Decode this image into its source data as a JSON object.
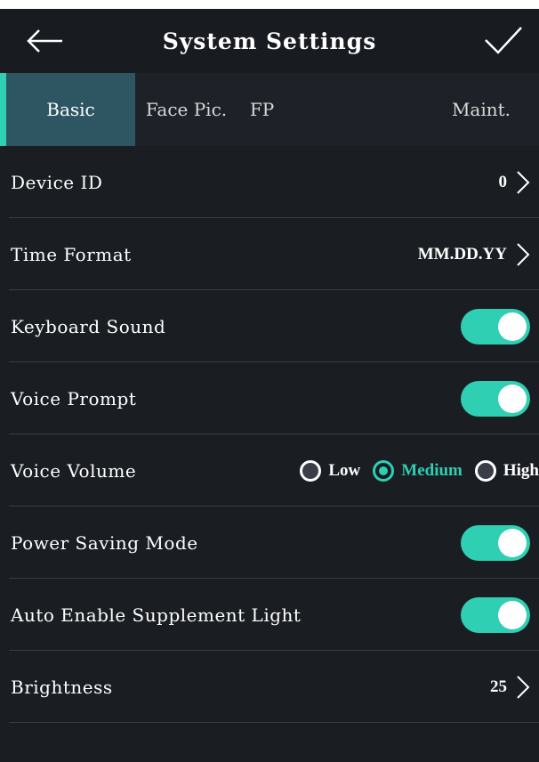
{
  "header": {
    "title": "System Settings",
    "back_icon": "arrow-left-icon",
    "confirm_icon": "check-icon"
  },
  "tabs": [
    {
      "label": "Basic",
      "active": true
    },
    {
      "label": "Face Pic.",
      "active": false
    },
    {
      "label": "FP",
      "active": false
    },
    {
      "label": "Maint.",
      "active": false
    }
  ],
  "settings": {
    "device_id": {
      "label": "Device ID",
      "value": "0"
    },
    "time_format": {
      "label": "Time Format",
      "value": "MM.DD.YY"
    },
    "keyboard_sound": {
      "label": "Keyboard Sound",
      "on": true
    },
    "voice_prompt": {
      "label": "Voice Prompt",
      "on": true
    },
    "voice_volume": {
      "label": "Voice Volume",
      "options": [
        "Low",
        "Medium",
        "High"
      ],
      "selected": "Medium"
    },
    "power_saving": {
      "label": "Power Saving Mode",
      "on": true
    },
    "supplement_light": {
      "label": "Auto Enable Supplement Light",
      "on": true
    },
    "brightness": {
      "label": "Brightness",
      "value": "25"
    }
  },
  "colors": {
    "accent": "#2ecfb2",
    "background": "#1a1d22",
    "active_tab": "#2d5562"
  }
}
